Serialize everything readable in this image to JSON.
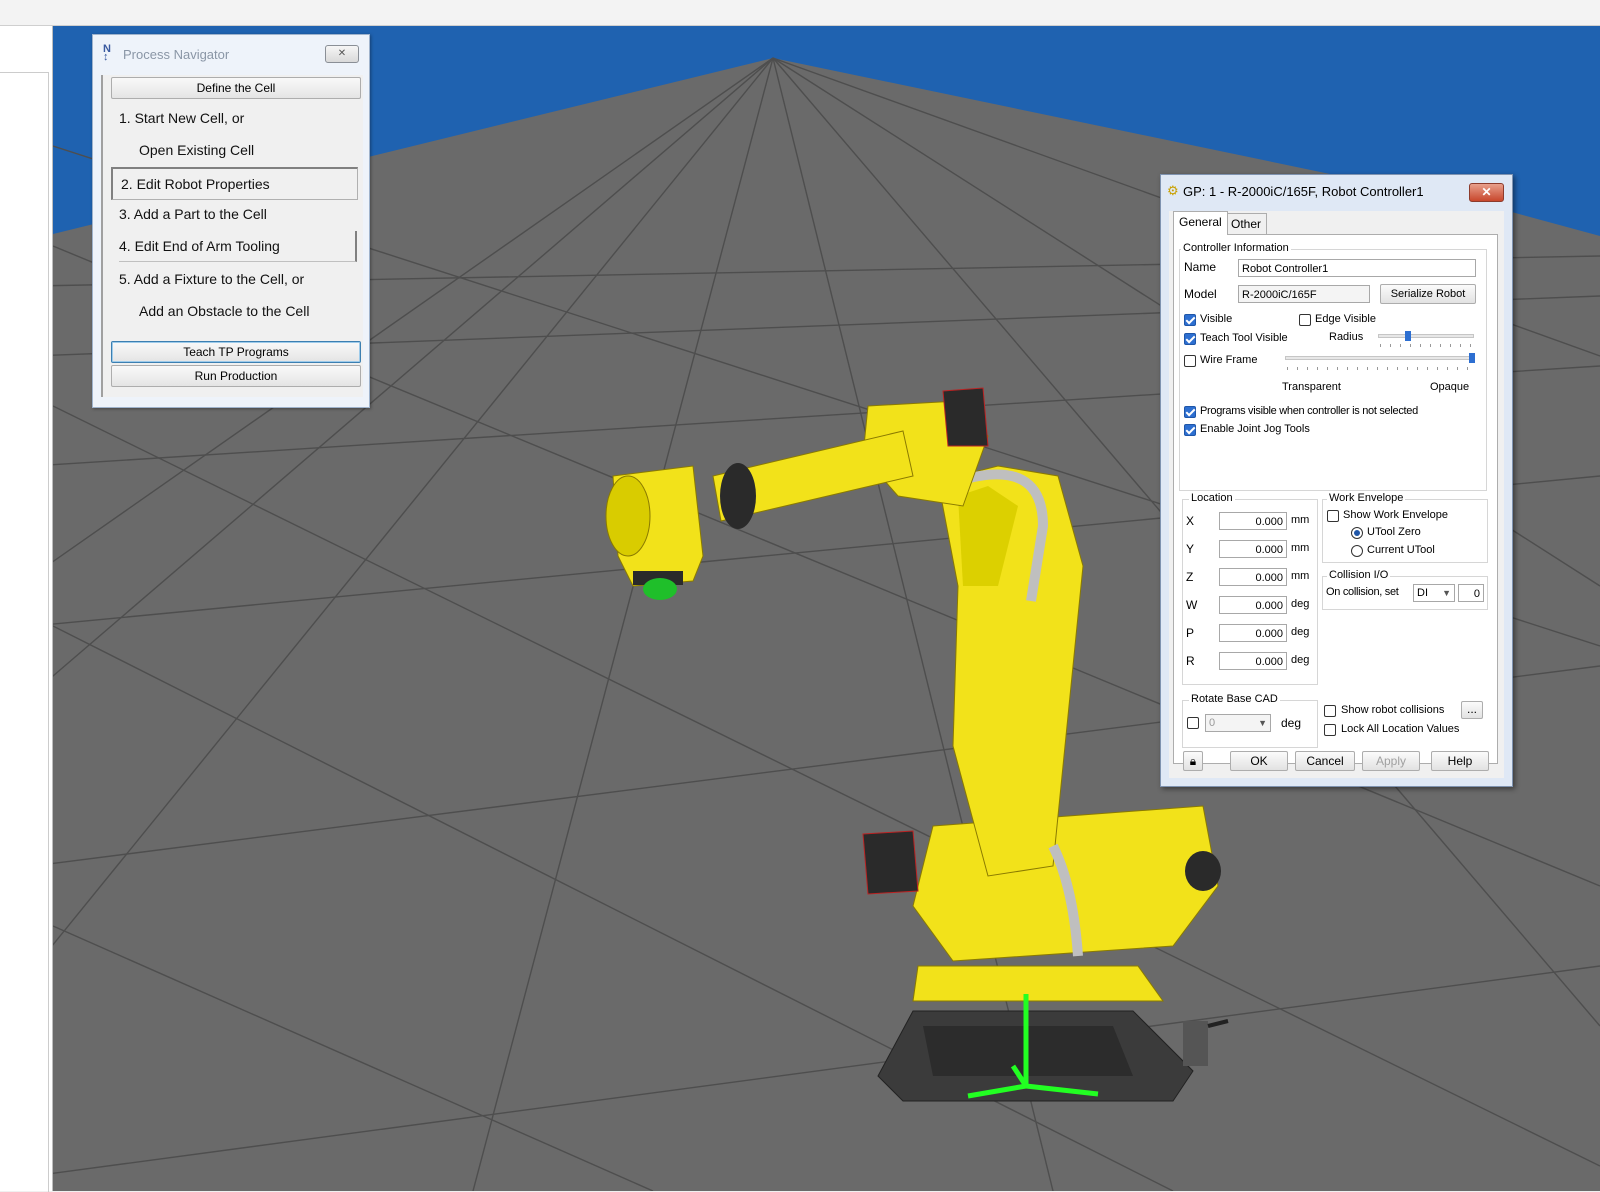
{
  "process_navigator": {
    "title": "Process Navigator",
    "close_glyph": "✕",
    "define_cell_label": "Define the Cell",
    "steps": [
      {
        "label": "1.  Start New Cell, or"
      },
      {
        "label": "Open Existing Cell"
      },
      {
        "label": "2.  Edit Robot Properties"
      },
      {
        "label": "3.  Add a Part to the Cell"
      },
      {
        "label": "4.  Edit End of Arm Tooling"
      },
      {
        "label": "5.  Add a Fixture to the Cell, or"
      },
      {
        "label": "Add an Obstacle to the Cell"
      }
    ],
    "teach_label": "Teach TP Programs",
    "run_label": "Run Production"
  },
  "robot_dialog": {
    "title": "GP: 1 - R-2000iC/165F, Robot Controller1",
    "close_glyph": "✕",
    "tabs": [
      {
        "label": "General"
      },
      {
        "label": "Other"
      }
    ],
    "controller_info": {
      "group_label": "Controller Information",
      "name_label": "Name",
      "name_value": "Robot Controller1",
      "model_label": "Model",
      "model_value": "R-2000iC/165F",
      "serialize_label": "Serialize Robot"
    },
    "visibility": {
      "visible_label": "Visible",
      "visible": true,
      "edge_visible_label": "Edge Visible",
      "edge_visible": false,
      "teach_tool_label": "Teach Tool Visible",
      "teach_tool": true,
      "radius_label": "Radius",
      "radius_level": 0.3,
      "wire_frame_label": "Wire Frame",
      "wire_frame": false,
      "transparent_label": "Transparent",
      "opaque_label": "Opaque",
      "opacity_level": 1.0,
      "programs_visible_label": "Programs visible when controller is not selected",
      "programs_visible": true,
      "joint_jog_label": "Enable Joint Jog Tools",
      "joint_jog": true
    },
    "location": {
      "group_label": "Location",
      "rows": [
        {
          "axis": "X",
          "value": "0.000",
          "unit": "mm"
        },
        {
          "axis": "Y",
          "value": "0.000",
          "unit": "mm"
        },
        {
          "axis": "Z",
          "value": "0.000",
          "unit": "mm"
        },
        {
          "axis": "W",
          "value": "0.000",
          "unit": "deg"
        },
        {
          "axis": "P",
          "value": "0.000",
          "unit": "deg"
        },
        {
          "axis": "R",
          "value": "0.000",
          "unit": "deg"
        }
      ]
    },
    "work_envelope": {
      "group_label": "Work Envelope",
      "show_label": "Show Work Envelope",
      "show": false,
      "utool_zero_label": "UTool Zero",
      "current_utool_label": "Current UTool",
      "selected": "UTool Zero"
    },
    "collision_io": {
      "group_label": "Collision I/O",
      "on_collision_label": "On collision, set",
      "io_type": "DI",
      "io_index": "0"
    },
    "rotate_base": {
      "group_label": "Rotate Base CAD",
      "enabled": false,
      "value": "0",
      "unit": "deg"
    },
    "show_collisions_label": "Show robot collisions",
    "more_label": "...",
    "lock_values_label": "Lock All Location Values",
    "buttons": {
      "ok": "OK",
      "cancel": "Cancel",
      "apply": "Apply",
      "help": "Help"
    }
  },
  "colors": {
    "sky": "#1f62b0",
    "floor": "#6b6b6b",
    "grid": "#4f4f4f",
    "robot_yellow": "#f2e21a",
    "robot_dark": "#2a2a2a",
    "accent_blue": "#2d6fd1"
  }
}
